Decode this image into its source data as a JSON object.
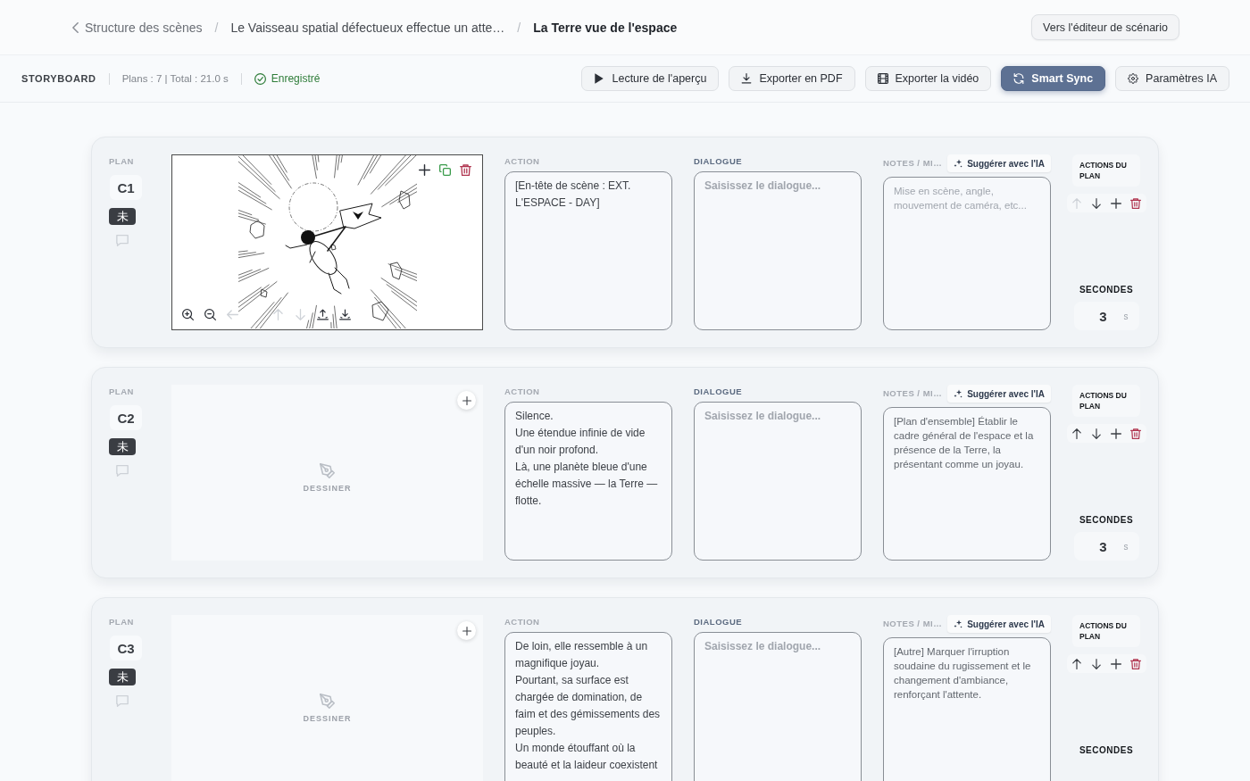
{
  "header": {
    "breadcrumb": [
      {
        "kind": "back",
        "label": "Structure des scènes"
      },
      {
        "kind": "separator",
        "label": "/"
      },
      {
        "kind": "link",
        "label": "Le Vaisseau spatial défectueux effectue un atte…"
      },
      {
        "kind": "separator",
        "label": "/"
      },
      {
        "kind": "current",
        "label": "La Terre vue de l'espace"
      }
    ],
    "button": "Vers l'éditeur de scénario"
  },
  "toolbar": {
    "title": "STORYBOARD",
    "summary": "Plans : 7 | Total : 21.0 s",
    "status": "Enregistré",
    "buttons": [
      {
        "kind": "preview",
        "label": "Lecture de l'aperçu",
        "primary": false
      },
      {
        "kind": "export-pdf",
        "label": "Exporter en PDF",
        "primary": false
      },
      {
        "kind": "export-video",
        "label": "Exporter la vidéo",
        "primary": false
      },
      {
        "kind": "sync",
        "label": "Smart Sync",
        "primary": true
      },
      {
        "kind": "settings",
        "label": "Paramètres IA",
        "primary": false
      }
    ]
  },
  "shots": [
    {
      "plan_label": "PLAN",
      "code": "C1",
      "badge": "未",
      "sketch": {
        "kind": "image",
        "top_tools": [
          {
            "kind": "add",
            "disabled": false
          },
          {
            "kind": "duplicate",
            "disabled": false
          },
          {
            "kind": "delete",
            "disabled": false
          }
        ],
        "bottom_tools": [
          {
            "kind": "zoom-in",
            "disabled": false
          },
          {
            "kind": "zoom-out",
            "disabled": false
          },
          {
            "kind": "left",
            "disabled": true
          },
          {
            "kind": "up",
            "disabled": true
          },
          {
            "kind": "down",
            "disabled": true
          },
          {
            "kind": "raise",
            "disabled": false
          },
          {
            "kind": "lower",
            "disabled": false
          }
        ]
      },
      "fields": [
        {
          "kind": "action",
          "label": "ACTION",
          "value": "[En-tête de scène : EXT. L'ESPACE - DAY]"
        },
        {
          "kind": "dialogue",
          "label": "DIALOGUE",
          "placeholder": "Saisissez le dialogue..."
        },
        {
          "kind": "notes",
          "label": "NOTES / MI…",
          "button": "Suggérer avec l'IA",
          "placeholder": "Mise en scène, angle, mouvement de caméra, etc..."
        }
      ],
      "actions_label": "ACTIONS DU PLAN",
      "actions": [
        {
          "kind": "up",
          "disabled": true
        },
        {
          "kind": "down",
          "disabled": false
        },
        {
          "kind": "add",
          "disabled": false
        },
        {
          "kind": "delete",
          "disabled": false
        }
      ],
      "seconds_label": "SECONDES",
      "seconds": "3",
      "unit": "s"
    },
    {
      "plan_label": "PLAN",
      "code": "C2",
      "badge": "未",
      "sketch": {
        "kind": "empty",
        "top_tools": [
          {
            "kind": "add",
            "disabled": false
          }
        ],
        "hint": "DESSINER"
      },
      "fields": [
        {
          "kind": "action",
          "label": "ACTION",
          "value": "Silence.\nUne étendue infinie de vide d'un noir profond.\nLà, une planète bleue d'une échelle massive — la Terre — flotte."
        },
        {
          "kind": "dialogue",
          "label": "DIALOGUE",
          "placeholder": "Saisissez le dialogue..."
        },
        {
          "kind": "notes",
          "label": "NOTES / MI…",
          "button": "Suggérer avec l'IA",
          "value": "[Plan d'ensemble] Établir le cadre général de l'espace et la présence de la Terre, la présentant comme un joyau."
        }
      ],
      "actions_label": "ACTIONS DU PLAN",
      "actions": [
        {
          "kind": "up",
          "disabled": false
        },
        {
          "kind": "down",
          "disabled": false
        },
        {
          "kind": "add",
          "disabled": false
        },
        {
          "kind": "delete",
          "disabled": false
        }
      ],
      "seconds_label": "SECONDES",
      "seconds": "3",
      "unit": "s"
    },
    {
      "plan_label": "PLAN",
      "code": "C3",
      "badge": "未",
      "sketch": {
        "kind": "empty",
        "top_tools": [
          {
            "kind": "add",
            "disabled": false
          }
        ],
        "hint": "DESSINER"
      },
      "fields": [
        {
          "kind": "action",
          "label": "ACTION",
          "value": "De loin, elle ressemble à un magnifique joyau.\nPourtant, sa surface est chargée de domination, de faim et des gémissements des peuples.\nUn monde étouffant où la beauté et la laideur coexistent"
        },
        {
          "kind": "dialogue",
          "label": "DIALOGUE",
          "placeholder": "Saisissez le dialogue..."
        },
        {
          "kind": "notes",
          "label": "NOTES / MI…",
          "button": "Suggérer avec l'IA",
          "value": "[Autre] Marquer l'irruption soudaine du rugissement et le changement d'ambiance, renforçant l'attente."
        }
      ],
      "actions_label": "ACTIONS DU PLAN",
      "actions": [
        {
          "kind": "up",
          "disabled": false
        },
        {
          "kind": "down",
          "disabled": false
        },
        {
          "kind": "add",
          "disabled": false
        },
        {
          "kind": "delete",
          "disabled": false
        }
      ],
      "seconds_label": "SECONDES"
    }
  ]
}
